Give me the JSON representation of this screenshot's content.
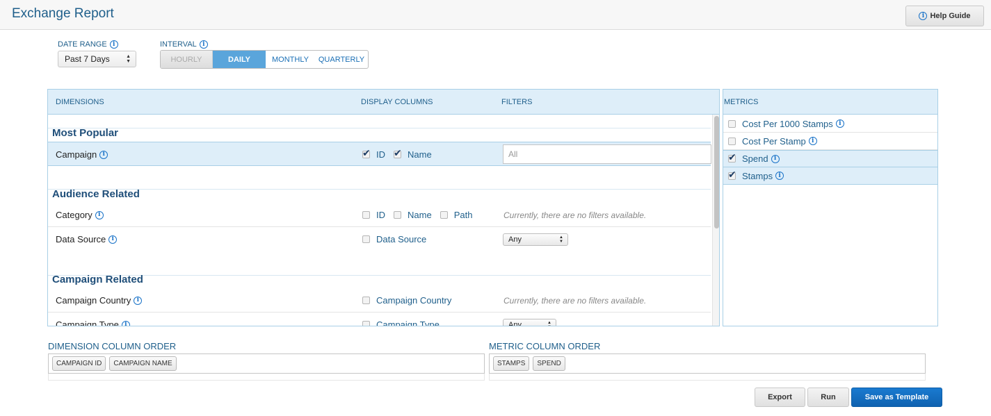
{
  "header": {
    "title": "Exchange Report",
    "help_label": "Help Guide"
  },
  "controls": {
    "date_range_label": "DATE RANGE",
    "date_range_value": "Past 7 Days",
    "interval_label": "INTERVAL",
    "intervals": [
      "HOURLY",
      "DAILY",
      "MONTHLY",
      "QUARTERLY"
    ],
    "selected_interval": "DAILY"
  },
  "dimensions": {
    "headers": {
      "dimensions": "DIMENSIONS",
      "display_columns": "DISPLAY COLUMNS",
      "filters": "FILTERS"
    },
    "sections": [
      {
        "title": "Most Popular",
        "rows": [
          {
            "name": "Campaign",
            "columns": [
              {
                "label": "ID",
                "checked": true
              },
              {
                "label": "Name",
                "checked": true
              }
            ],
            "filter_value": "All"
          }
        ]
      },
      {
        "title": "Audience Related",
        "rows": [
          {
            "name": "Category",
            "columns": [
              {
                "label": "ID",
                "checked": false
              },
              {
                "label": "Name",
                "checked": false
              },
              {
                "label": "Path",
                "checked": false
              }
            ],
            "filter_note": "Currently, there are no filters available."
          },
          {
            "name": "Data Source",
            "columns": [
              {
                "label": "Data Source",
                "checked": false
              }
            ],
            "filter_select": "Any"
          }
        ]
      },
      {
        "title": "Campaign Related",
        "rows": [
          {
            "name": "Campaign Country",
            "columns": [
              {
                "label": "Campaign Country",
                "checked": false
              }
            ],
            "filter_note": "Currently, there are no filters available."
          },
          {
            "name": "Campaign Type",
            "columns": [
              {
                "label": "Campaign Type",
                "checked": false
              }
            ],
            "filter_select": "Any"
          }
        ]
      }
    ]
  },
  "metrics": {
    "header": "METRICS",
    "items": [
      {
        "label": "Cost Per 1000 Stamps",
        "checked": false
      },
      {
        "label": "Cost Per Stamp",
        "checked": false
      },
      {
        "label": "Spend",
        "checked": true
      },
      {
        "label": "Stamps",
        "checked": true
      }
    ]
  },
  "column_order": {
    "dimension_label": "DIMENSION COLUMN ORDER",
    "dimension_chips": [
      "CAMPAIGN ID",
      "CAMPAIGN NAME"
    ],
    "metric_label": "METRIC COLUMN ORDER",
    "metric_chips": [
      "STAMPS",
      "SPEND"
    ]
  },
  "actions": {
    "export": "Export",
    "run": "Run",
    "save_template": "Save as Template"
  },
  "colors": {
    "accent": "#1a6fb5",
    "selected_interval": "#5aa5db",
    "row_highlight": "#deeef9",
    "primary_button": "#1670c2"
  }
}
